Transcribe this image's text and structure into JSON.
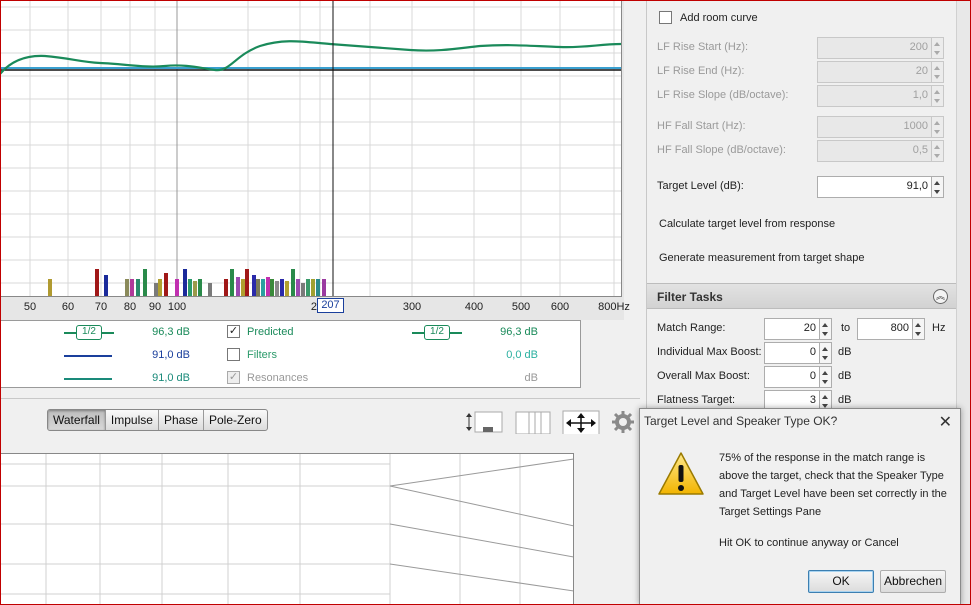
{
  "graph": {
    "x_ticks": [
      "50",
      "60",
      "70",
      "80",
      "90",
      "100",
      "200",
      "300",
      "400",
      "500",
      "600",
      "800Hz"
    ],
    "cursor_value": "207",
    "colors": {
      "predicted": "#1a8a5a",
      "target": "#3aa0d0",
      "baseline": "#111111",
      "grid": "#d8d8d8"
    }
  },
  "legend": {
    "rows": [
      {
        "smoothing": "1/2",
        "left_value": "96,3 dB",
        "checked": true,
        "name": "Predicted",
        "right_smoothing": "1/2",
        "right_value": "96,3 dB",
        "color": "#1a8a5a"
      },
      {
        "left_value": "91,0 dB",
        "checked": false,
        "name": "Filters",
        "right_value": "0,0 dB",
        "color": "#1a3f9c",
        "name_color": "#2a9a6a",
        "right_color": "#2ab0a0"
      },
      {
        "left_value": "91,0 dB",
        "checked": true,
        "disabled": true,
        "name": "Resonances",
        "right_value": "dB",
        "color": "#1a8a7a",
        "name_color": "#999999",
        "right_color": "#999999"
      }
    ]
  },
  "graph_tabs": {
    "items": [
      "Waterfall",
      "Impulse",
      "Phase",
      "Pole-Zero"
    ],
    "active": "Waterfall"
  },
  "target_settings": {
    "room_curve_label": "Add room curve",
    "room_curve_checked": false,
    "fields": [
      {
        "label": "LF Rise Start (Hz):",
        "value": "200",
        "disabled": true
      },
      {
        "label": "LF Rise End (Hz):",
        "value": "20",
        "disabled": true
      },
      {
        "label": "LF Rise Slope (dB/octave):",
        "value": "1,0",
        "disabled": true
      },
      {
        "label": "HF Fall Start (Hz):",
        "value": "1000",
        "disabled": true
      },
      {
        "label": "HF Fall Slope (dB/octave):",
        "value": "0,5",
        "disabled": true
      },
      {
        "label": "Target Level (dB):",
        "value": "91,0",
        "disabled": false
      }
    ],
    "calc_link": "Calculate target level from response",
    "generate_link": "Generate measurement from target shape"
  },
  "filter_tasks": {
    "title": "Filter Tasks",
    "match_range_label": "Match Range:",
    "match_from": "20",
    "to_label": "to",
    "match_to": "800",
    "hz_label": "Hz",
    "individual_boost_label": "Individual Max Boost:",
    "individual_boost": "0",
    "overall_boost_label": "Overall Max Boost:",
    "overall_boost": "0",
    "flatness_label": "Flatness Target:",
    "flatness": "3",
    "db_label": "dB"
  },
  "dialog": {
    "title": "Target Level and Speaker Type OK?",
    "message": "75% of the response in the match range is above the target, check that the Speaker Type and Target Level have been set correctly in the Target Settings Pane",
    "message2": "Hit OK to continue anyway or Cancel",
    "ok_label": "OK",
    "cancel_label": "Abbrechen"
  }
}
